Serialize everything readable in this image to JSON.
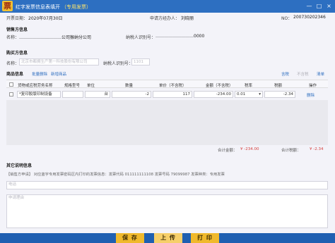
{
  "window": {
    "title": "红字发票信息表填开",
    "subtitle": "（专用发票）",
    "logo": "票",
    "controls": [
      "—",
      "□",
      "×"
    ]
  },
  "header": {
    "date_label": "开票日期：",
    "date_value": "2020年07月30日",
    "applicant_label": "申请方经办人：",
    "applicant_value": "刘晓丽",
    "no_label": "NO：",
    "no_value": "200730202346"
  },
  "seller": {
    "section": "销售方信息",
    "name_label": "名称：",
    "name_value": "…………………………公司猴纳分公司",
    "tax_label": "纳税人识别号：",
    "tax_value": "………………………0000"
  },
  "buyer": {
    "section": "购买方信息",
    "name_label": "名称：",
    "name_placeholder": "北京市都拥生产第一科技股份有限公司",
    "tax_label": "纳税人识别号：",
    "tax_placeholder": "1101"
  },
  "goods": {
    "section": "商品信息",
    "actions": [
      "批量删除",
      "新增商品"
    ],
    "right_actions": [
      "含税",
      "不含税",
      "清单"
    ],
    "columns": [
      "货物或应税劳务名称",
      "规格型号",
      "单位",
      "数量",
      "单价（不含税）",
      "金额（不含税）",
      "税率",
      "税额",
      "操作"
    ],
    "row": {
      "name": "*复印胶版印制设备",
      "spec": "",
      "unit": "台",
      "qty": "-2",
      "price": "117",
      "amount": "-234.00",
      "rate": "0.01",
      "tax": "-2.34",
      "op": "删除"
    }
  },
  "totals": {
    "amount_label": "合计金额：",
    "amount_value": "¥ -234.00",
    "tax_label": "合计税额：",
    "tax_value": "¥ -2.34"
  },
  "other": {
    "section": "其它说明信息",
    "note": "【销售方申请】 对应蓝字专用发票密码区内打印的发票信息：发票代码 011111111108 发票号码 79099987 发票种类：专用发票",
    "phone_placeholder": "电话",
    "remark_placeholder": "申请理由"
  },
  "buttons": {
    "save": "保 存",
    "upload": "上 传",
    "print": "打 印"
  },
  "colors": {
    "titlebar": "#2d6fc1",
    "button": "#f0b92c",
    "negative": "#d6413d",
    "link": "#2f6fc0"
  }
}
